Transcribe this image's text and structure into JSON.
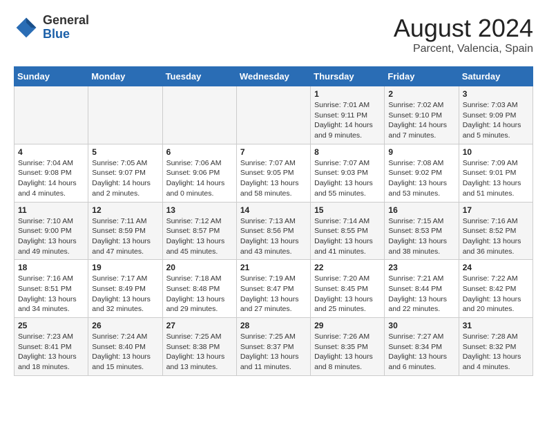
{
  "header": {
    "logo_general": "General",
    "logo_blue": "Blue",
    "title": "August 2024",
    "subtitle": "Parcent, Valencia, Spain"
  },
  "days_of_week": [
    "Sunday",
    "Monday",
    "Tuesday",
    "Wednesday",
    "Thursday",
    "Friday",
    "Saturday"
  ],
  "weeks": [
    [
      {
        "day": "",
        "detail": ""
      },
      {
        "day": "",
        "detail": ""
      },
      {
        "day": "",
        "detail": ""
      },
      {
        "day": "",
        "detail": ""
      },
      {
        "day": "1",
        "detail": "Sunrise: 7:01 AM\nSunset: 9:11 PM\nDaylight: 14 hours\nand 9 minutes."
      },
      {
        "day": "2",
        "detail": "Sunrise: 7:02 AM\nSunset: 9:10 PM\nDaylight: 14 hours\nand 7 minutes."
      },
      {
        "day": "3",
        "detail": "Sunrise: 7:03 AM\nSunset: 9:09 PM\nDaylight: 14 hours\nand 5 minutes."
      }
    ],
    [
      {
        "day": "4",
        "detail": "Sunrise: 7:04 AM\nSunset: 9:08 PM\nDaylight: 14 hours\nand 4 minutes."
      },
      {
        "day": "5",
        "detail": "Sunrise: 7:05 AM\nSunset: 9:07 PM\nDaylight: 14 hours\nand 2 minutes."
      },
      {
        "day": "6",
        "detail": "Sunrise: 7:06 AM\nSunset: 9:06 PM\nDaylight: 14 hours\nand 0 minutes."
      },
      {
        "day": "7",
        "detail": "Sunrise: 7:07 AM\nSunset: 9:05 PM\nDaylight: 13 hours\nand 58 minutes."
      },
      {
        "day": "8",
        "detail": "Sunrise: 7:07 AM\nSunset: 9:03 PM\nDaylight: 13 hours\nand 55 minutes."
      },
      {
        "day": "9",
        "detail": "Sunrise: 7:08 AM\nSunset: 9:02 PM\nDaylight: 13 hours\nand 53 minutes."
      },
      {
        "day": "10",
        "detail": "Sunrise: 7:09 AM\nSunset: 9:01 PM\nDaylight: 13 hours\nand 51 minutes."
      }
    ],
    [
      {
        "day": "11",
        "detail": "Sunrise: 7:10 AM\nSunset: 9:00 PM\nDaylight: 13 hours\nand 49 minutes."
      },
      {
        "day": "12",
        "detail": "Sunrise: 7:11 AM\nSunset: 8:59 PM\nDaylight: 13 hours\nand 47 minutes."
      },
      {
        "day": "13",
        "detail": "Sunrise: 7:12 AM\nSunset: 8:57 PM\nDaylight: 13 hours\nand 45 minutes."
      },
      {
        "day": "14",
        "detail": "Sunrise: 7:13 AM\nSunset: 8:56 PM\nDaylight: 13 hours\nand 43 minutes."
      },
      {
        "day": "15",
        "detail": "Sunrise: 7:14 AM\nSunset: 8:55 PM\nDaylight: 13 hours\nand 41 minutes."
      },
      {
        "day": "16",
        "detail": "Sunrise: 7:15 AM\nSunset: 8:53 PM\nDaylight: 13 hours\nand 38 minutes."
      },
      {
        "day": "17",
        "detail": "Sunrise: 7:16 AM\nSunset: 8:52 PM\nDaylight: 13 hours\nand 36 minutes."
      }
    ],
    [
      {
        "day": "18",
        "detail": "Sunrise: 7:16 AM\nSunset: 8:51 PM\nDaylight: 13 hours\nand 34 minutes."
      },
      {
        "day": "19",
        "detail": "Sunrise: 7:17 AM\nSunset: 8:49 PM\nDaylight: 13 hours\nand 32 minutes."
      },
      {
        "day": "20",
        "detail": "Sunrise: 7:18 AM\nSunset: 8:48 PM\nDaylight: 13 hours\nand 29 minutes."
      },
      {
        "day": "21",
        "detail": "Sunrise: 7:19 AM\nSunset: 8:47 PM\nDaylight: 13 hours\nand 27 minutes."
      },
      {
        "day": "22",
        "detail": "Sunrise: 7:20 AM\nSunset: 8:45 PM\nDaylight: 13 hours\nand 25 minutes."
      },
      {
        "day": "23",
        "detail": "Sunrise: 7:21 AM\nSunset: 8:44 PM\nDaylight: 13 hours\nand 22 minutes."
      },
      {
        "day": "24",
        "detail": "Sunrise: 7:22 AM\nSunset: 8:42 PM\nDaylight: 13 hours\nand 20 minutes."
      }
    ],
    [
      {
        "day": "25",
        "detail": "Sunrise: 7:23 AM\nSunset: 8:41 PM\nDaylight: 13 hours\nand 18 minutes."
      },
      {
        "day": "26",
        "detail": "Sunrise: 7:24 AM\nSunset: 8:40 PM\nDaylight: 13 hours\nand 15 minutes."
      },
      {
        "day": "27",
        "detail": "Sunrise: 7:25 AM\nSunset: 8:38 PM\nDaylight: 13 hours\nand 13 minutes."
      },
      {
        "day": "28",
        "detail": "Sunrise: 7:25 AM\nSunset: 8:37 PM\nDaylight: 13 hours\nand 11 minutes."
      },
      {
        "day": "29",
        "detail": "Sunrise: 7:26 AM\nSunset: 8:35 PM\nDaylight: 13 hours\nand 8 minutes."
      },
      {
        "day": "30",
        "detail": "Sunrise: 7:27 AM\nSunset: 8:34 PM\nDaylight: 13 hours\nand 6 minutes."
      },
      {
        "day": "31",
        "detail": "Sunrise: 7:28 AM\nSunset: 8:32 PM\nDaylight: 13 hours\nand 4 minutes."
      }
    ]
  ]
}
